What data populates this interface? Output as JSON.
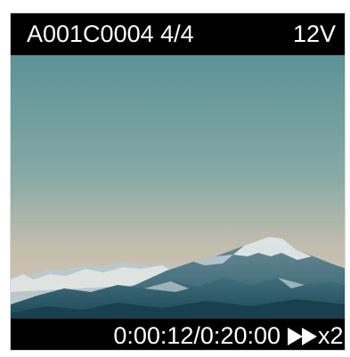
{
  "header": {
    "clip_name": "A001C0004 4/4",
    "voltage": "12V"
  },
  "footer": {
    "timecode": "0:00:12/0:20:00",
    "playback_speed": "x2",
    "speed_icon": "fast-forward-icon"
  },
  "colors": {
    "bar_background": "#000000",
    "text": "#ffffff",
    "sky_top": "#5f9498",
    "sky_bottom": "#d7c3b2"
  }
}
